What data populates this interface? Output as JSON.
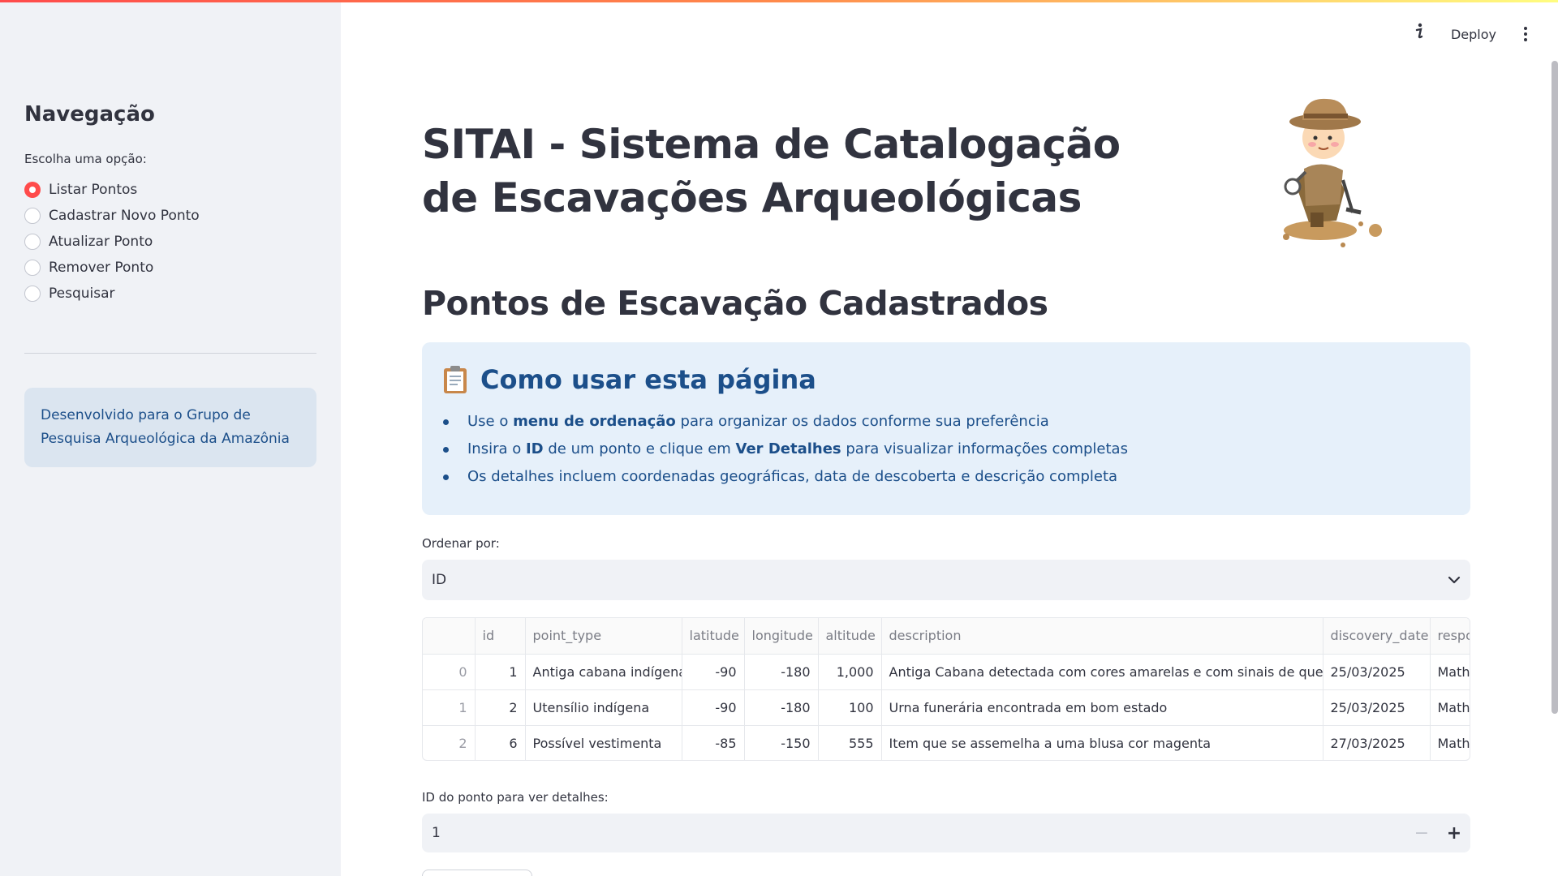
{
  "header": {
    "deploy_label": "Deploy",
    "info_icon": "info-icon",
    "menu_icon": "kebab-menu-icon"
  },
  "sidebar": {
    "title": "Navegação",
    "radio_label": "Escolha uma opção:",
    "options": [
      {
        "label": "Listar Pontos",
        "selected": true
      },
      {
        "label": "Cadastrar Novo Ponto",
        "selected": false
      },
      {
        "label": "Atualizar Ponto",
        "selected": false
      },
      {
        "label": "Remover Ponto",
        "selected": false
      },
      {
        "label": "Pesquisar",
        "selected": false
      }
    ],
    "info_text": "Desenvolvido para o Grupo de Pesquisa Arqueológica da Amazônia"
  },
  "main": {
    "title": "SITAI - Sistema de Catalogação de Escavações Arqueológicas",
    "subtitle": "Pontos de Escavação Cadastrados",
    "help": {
      "heading": "Como usar esta página",
      "items": [
        {
          "pre": "Use o ",
          "bold": "menu de ordenação",
          "post": " para organizar os dados conforme sua preferência"
        },
        {
          "pre": "Insira o ",
          "bold": "ID",
          "mid": " de um ponto e clique em ",
          "bold2": "Ver Detalhes",
          "post": " para visualizar informações completas"
        },
        {
          "pre": "Os detalhes incluem coordenadas geográficas, data de descoberta e descrição completa"
        }
      ]
    },
    "order_label": "Ordenar por:",
    "order_value": "ID",
    "table": {
      "columns": [
        "",
        "id",
        "point_type",
        "latitude",
        "longitude",
        "altitude",
        "description",
        "discovery_date",
        "respo"
      ],
      "rows": [
        [
          "0",
          "1",
          "Antiga cabana indígena",
          "-90",
          "-180",
          "1,000",
          "Antiga Cabana detectada com cores amarelas e com sinais de queimada",
          "25/03/2025",
          "Math"
        ],
        [
          "1",
          "2",
          "Utensílio indígena",
          "-90",
          "-180",
          "100",
          "Urna funerária encontrada em bom estado",
          "25/03/2025",
          "Math"
        ],
        [
          "2",
          "6",
          "Possível vestimenta",
          "-85",
          "-150",
          "555",
          "Item que se assemelha a uma blusa cor magenta",
          "27/03/2025",
          "Math"
        ]
      ]
    },
    "detail_label": "ID do ponto para ver detalhes:",
    "detail_value": "1",
    "colors": {
      "accent": "#ff4b4b",
      "info_bg": "#e6f0fa",
      "info_text": "#1c4f8a",
      "sidebar_bg": "#f0f2f6"
    }
  }
}
